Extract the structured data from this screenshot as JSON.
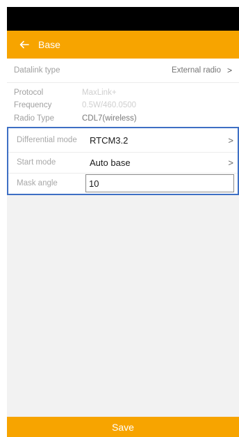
{
  "header": {
    "title": "Base",
    "back_icon": "arrow-left-icon"
  },
  "datalink": {
    "label": "Datalink type",
    "value": "External radio",
    "chevron": ">"
  },
  "info": {
    "protocol_label": "Protocol",
    "protocol_value": "MaxLink+",
    "frequency_label": "Frequency",
    "frequency_value": "0.5W/460.0500",
    "radio_type_label": "Radio Type",
    "radio_type_value": "CDL7(wireless)"
  },
  "settings": {
    "differential_mode_label": "Differential mode",
    "differential_mode_value": "RTCM3.2",
    "start_mode_label": "Start mode",
    "start_mode_value": "Auto base",
    "mask_angle_label": "Mask angle",
    "mask_angle_value": "10",
    "chevron": ">"
  },
  "footer": {
    "save_label": "Save"
  },
  "colors": {
    "accent": "#f7a400",
    "highlight_border": "#3e6fc4"
  }
}
